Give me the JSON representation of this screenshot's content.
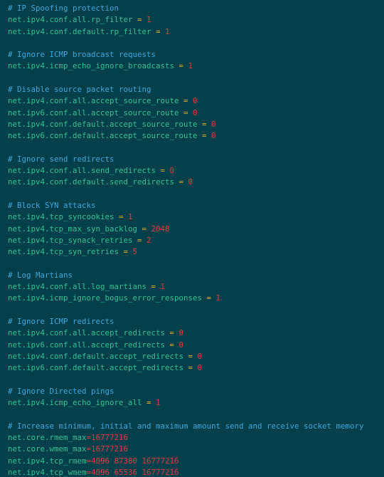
{
  "editor": {
    "name": "sysctl-config-file",
    "colors": {
      "background": "#03404b",
      "comment": "#3ba6da",
      "key": "#2ebf93",
      "operator": "#d2ae2f",
      "value": "#e03a40"
    },
    "lines": [
      {
        "type": "comment",
        "text": "# IP Spoofing protection"
      },
      {
        "type": "setting",
        "key": "net.ipv4.conf.all.rp_filter",
        "op": " = ",
        "value": "1"
      },
      {
        "type": "setting",
        "key": "net.ipv4.conf.default.rp_filter",
        "op": " = ",
        "value": "1"
      },
      {
        "type": "blank",
        "text": ""
      },
      {
        "type": "comment",
        "text": "# Ignore ICMP broadcast requests"
      },
      {
        "type": "setting",
        "key": "net.ipv4.icmp_echo_ignore_broadcasts",
        "op": " = ",
        "value": "1"
      },
      {
        "type": "blank",
        "text": ""
      },
      {
        "type": "comment",
        "text": "# Disable source packet routing"
      },
      {
        "type": "setting",
        "key": "net.ipv4.conf.all.accept_source_route",
        "op": " = ",
        "value": "0"
      },
      {
        "type": "setting",
        "key": "net.ipv6.conf.all.accept_source_route",
        "op": " = ",
        "value": "0"
      },
      {
        "type": "setting",
        "key": "net.ipv4.conf.default.accept_source_route",
        "op": " = ",
        "value": "0"
      },
      {
        "type": "setting",
        "key": "net.ipv6.conf.default.accept_source_route",
        "op": " = ",
        "value": "0"
      },
      {
        "type": "blank",
        "text": ""
      },
      {
        "type": "comment",
        "text": "# Ignore send redirects"
      },
      {
        "type": "setting",
        "key": "net.ipv4.conf.all.send_redirects",
        "op": " = ",
        "value": "0"
      },
      {
        "type": "setting",
        "key": "net.ipv4.conf.default.send_redirects",
        "op": " = ",
        "value": "0"
      },
      {
        "type": "blank",
        "text": ""
      },
      {
        "type": "comment",
        "text": "# Block SYN attacks"
      },
      {
        "type": "setting",
        "key": "net.ipv4.tcp_syncookies",
        "op": " = ",
        "value": "1"
      },
      {
        "type": "setting",
        "key": "net.ipv4.tcp_max_syn_backlog",
        "op": " = ",
        "value": "2048"
      },
      {
        "type": "setting",
        "key": "net.ipv4.tcp_synack_retries",
        "op": " = ",
        "value": "2"
      },
      {
        "type": "setting",
        "key": "net.ipv4.tcp_syn_retries",
        "op": " = ",
        "value": "5"
      },
      {
        "type": "blank",
        "text": ""
      },
      {
        "type": "comment",
        "text": "# Log Martians"
      },
      {
        "type": "setting",
        "key": "net.ipv4.conf.all.log_martians",
        "op": " = ",
        "value": "1"
      },
      {
        "type": "setting",
        "key": "net.ipv4.icmp_ignore_bogus_error_responses",
        "op": " = ",
        "value": "1"
      },
      {
        "type": "blank",
        "text": ""
      },
      {
        "type": "comment",
        "text": "# Ignore ICMP redirects"
      },
      {
        "type": "setting",
        "key": "net.ipv4.conf.all.accept_redirects",
        "op": " = ",
        "value": "0"
      },
      {
        "type": "setting",
        "key": "net.ipv6.conf.all.accept_redirects",
        "op": " = ",
        "value": "0"
      },
      {
        "type": "setting",
        "key": "net.ipv4.conf.default.accept_redirects",
        "op": " = ",
        "value": "0"
      },
      {
        "type": "setting",
        "key": "net.ipv6.conf.default.accept_redirects",
        "op": " = ",
        "value": "0"
      },
      {
        "type": "blank",
        "text": ""
      },
      {
        "type": "comment",
        "text": "# Ignore Directed pings"
      },
      {
        "type": "setting",
        "key": "net.ipv4.icmp_echo_ignore_all",
        "op": " = ",
        "value": "1"
      },
      {
        "type": "blank",
        "text": ""
      },
      {
        "type": "comment",
        "text": "# Increase minimum, initial and maximum amount send and receive socket memory"
      },
      {
        "type": "setting-tight",
        "key": "net.core.rmem_max",
        "op": "=",
        "value": "16777216"
      },
      {
        "type": "setting-tight",
        "key": "net.core.wmem_max",
        "op": "=",
        "value": "16777216"
      },
      {
        "type": "setting-tight",
        "key": "net.ipv4.tcp_rmem",
        "op": "=",
        "value": "4096 87380 16777216"
      },
      {
        "type": "setting-tight",
        "key": "net.ipv4.tcp_wmem",
        "op": "=",
        "value": "4096 65536 16777216"
      }
    ]
  }
}
